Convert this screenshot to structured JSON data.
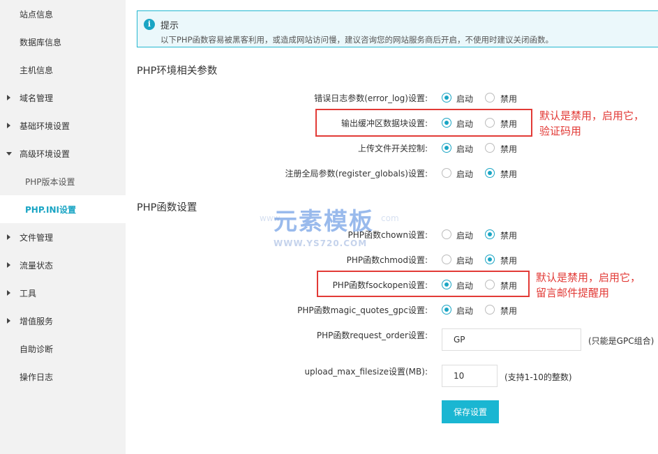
{
  "sidebar": {
    "items": [
      {
        "label": "站点信息",
        "arrow": "none"
      },
      {
        "label": "数据库信息",
        "arrow": "none"
      },
      {
        "label": "主机信息",
        "arrow": "none"
      },
      {
        "label": "域名管理",
        "arrow": "right"
      },
      {
        "label": "基础环境设置",
        "arrow": "right"
      },
      {
        "label": "高级环境设置",
        "arrow": "down"
      },
      {
        "label": "PHP版本设置",
        "arrow": "none"
      },
      {
        "label": "PHP.INI设置",
        "arrow": "none"
      },
      {
        "label": "文件管理",
        "arrow": "right"
      },
      {
        "label": "流量状态",
        "arrow": "right"
      },
      {
        "label": "工具",
        "arrow": "right"
      },
      {
        "label": "增值服务",
        "arrow": "right"
      },
      {
        "label": "自助诊断",
        "arrow": "none"
      },
      {
        "label": "操作日志",
        "arrow": "none"
      }
    ]
  },
  "tip": {
    "icon": "info-icon",
    "title": "提示",
    "text": "以下PHP函数容易被黑客利用，或造成网站访问慢，建议咨询您的网站服务商后开启，不使用时建议关闭函数。"
  },
  "env_section": {
    "title": "PHP环境相关参数",
    "rows": [
      {
        "label": "错误日志参数(error_log)设置:",
        "on_label": "启动",
        "off_label": "禁用",
        "value": "启动"
      },
      {
        "label": "输出缓冲区数据块设置:",
        "on_label": "启动",
        "off_label": "禁用",
        "value": "启动"
      },
      {
        "label": "上传文件开关控制:",
        "on_label": "启动",
        "off_label": "禁用",
        "value": "启动"
      },
      {
        "label": "注册全局参数(register_globals)设置:",
        "on_label": "启动",
        "off_label": "禁用",
        "value": "禁用"
      }
    ]
  },
  "func_section": {
    "title": "PHP函数设置",
    "rows": [
      {
        "label": "PHP函数chown设置:",
        "on_label": "启动",
        "off_label": "禁用",
        "value": "禁用"
      },
      {
        "label": "PHP函数chmod设置:",
        "on_label": "启动",
        "off_label": "禁用",
        "value": "禁用"
      },
      {
        "label": "PHP函数fsockopen设置:",
        "on_label": "启动",
        "off_label": "禁用",
        "value": "启动"
      },
      {
        "label": "PHP函数magic_quotes_gpc设置:",
        "on_label": "启动",
        "off_label": "禁用",
        "value": "启动"
      }
    ],
    "request_order": {
      "label": "PHP函数request_order设置:",
      "value": "GP",
      "hint": "(只能是GPC组合)"
    },
    "upload_max": {
      "label": "upload_max_filesize设置(MB):",
      "value": "10",
      "hint": "(支持1-10的整数)"
    }
  },
  "save_label": "保存设置",
  "annotations": {
    "note1_line1": "默认是禁用，启用它，",
    "note1_line2": "验证码用",
    "note2_line1": "默认是禁用，启用它，",
    "note2_line2": "留言邮件提醒用",
    "color": "#e23a36"
  },
  "watermark": {
    "main": "元素模板",
    "sub": "WWW.YS720.COM",
    "left": "www",
    "right": "com"
  },
  "colors": {
    "accent": "#1aa5c4",
    "sidebar_bg": "#f2f2f2",
    "tip_border": "#23b7d0"
  }
}
